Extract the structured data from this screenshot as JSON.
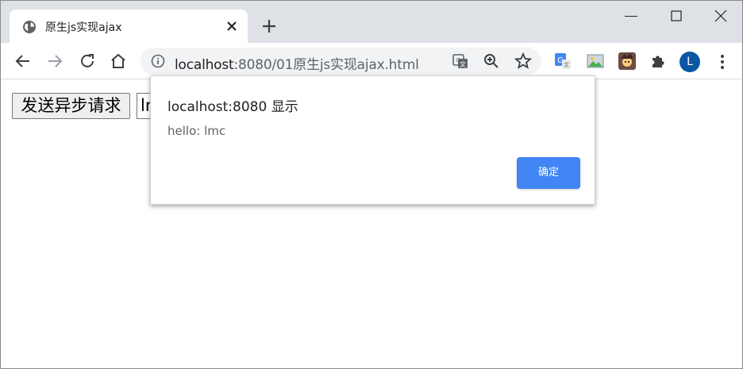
{
  "tab": {
    "title": "原生js实现ajax",
    "favicon": "globe-icon",
    "close": "close-icon"
  },
  "new_tab": "plus-icon",
  "window_controls": [
    "minimize-icon",
    "maximize-icon",
    "close-icon"
  ],
  "toolbar": {
    "back": "arrow-left-icon",
    "forward": "arrow-right-icon",
    "reload": "reload-icon",
    "home": "home-icon",
    "url_host": "localhost",
    "url_path": ":8080/01原生js实现ajax.html",
    "omnibox_actions": [
      "translate-icon",
      "zoom-icon",
      "star-icon"
    ],
    "extensions": [
      "google-translate-extension-icon",
      "image-extension-icon",
      "character-extension-icon",
      "puzzle-icon"
    ],
    "avatar_letter": "L",
    "menu": "more-vert-icon"
  },
  "page": {
    "send_button_label": "发送异步请求",
    "name_input_value": "lmc"
  },
  "dialog": {
    "title": "localhost:8080 显示",
    "message": "hello: lmc",
    "ok_label": "确定"
  },
  "colors": {
    "accent": "#4285f4",
    "tabstrip": "#dee1e6",
    "avatar": "#0b57a4"
  }
}
